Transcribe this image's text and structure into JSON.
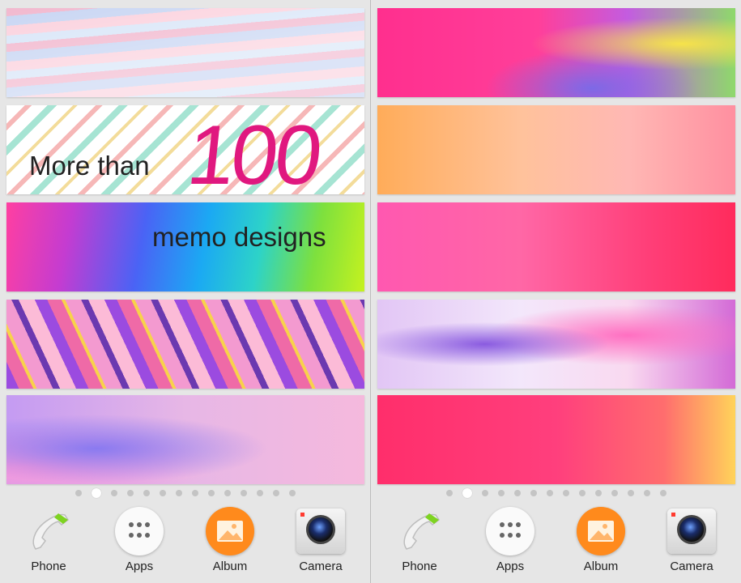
{
  "left": {
    "promo": {
      "line1": "More than",
      "number": "100",
      "line2": "memo designs"
    },
    "memos": [
      "L1",
      "L2",
      "L3",
      "L4",
      "L5"
    ],
    "page_indicator": {
      "count": 14,
      "active_index": 1
    },
    "dock": [
      {
        "label": "Phone",
        "icon": "phone-icon"
      },
      {
        "label": "Apps",
        "icon": "apps-grid-icon"
      },
      {
        "label": "Album",
        "icon": "album-icon"
      },
      {
        "label": "Camera",
        "icon": "camera-icon"
      }
    ]
  },
  "right": {
    "memos": [
      "R1",
      "R2",
      "R3",
      "R4",
      "R5"
    ],
    "page_indicator": {
      "count": 14,
      "active_index": 1
    },
    "dock": [
      {
        "label": "Phone",
        "icon": "phone-icon"
      },
      {
        "label": "Apps",
        "icon": "apps-grid-icon"
      },
      {
        "label": "Album",
        "icon": "album-icon"
      },
      {
        "label": "Camera",
        "icon": "camera-icon"
      }
    ]
  },
  "colors": {
    "promo_number": "#e0187f",
    "album_orange": "#ff8a1c",
    "phone_green": "#7ed321"
  }
}
